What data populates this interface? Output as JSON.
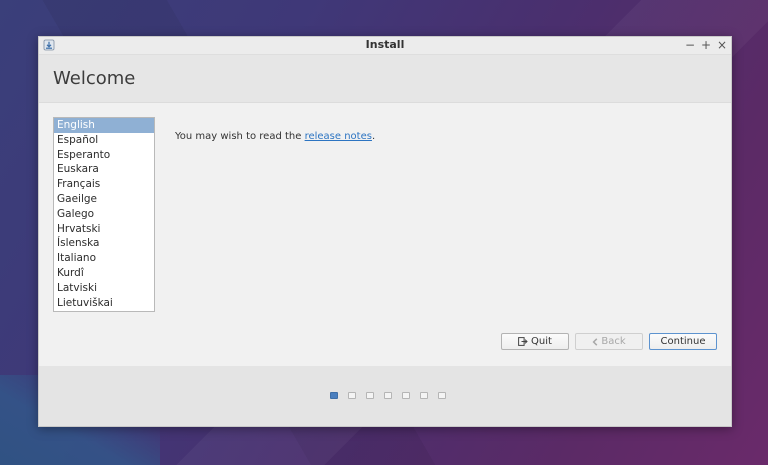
{
  "window": {
    "title": "Install",
    "controls": {
      "minimize": "−",
      "maximize": "+",
      "close": "×"
    }
  },
  "header": {
    "title": "Welcome"
  },
  "languages": {
    "selected_index": 0,
    "items": [
      "English",
      "Español",
      "Esperanto",
      "Euskara",
      "Français",
      "Gaeilge",
      "Galego",
      "Hrvatski",
      "Íslenska",
      "Italiano",
      "Kurdî",
      "Latviski",
      "Lietuviškai"
    ]
  },
  "notes": {
    "prefix": "You may wish to read the ",
    "link": "release notes",
    "suffix": "."
  },
  "buttons": {
    "quit": "Quit",
    "back": "Back",
    "continue": "Continue"
  },
  "progress": {
    "total_steps": 7,
    "current_step": 1
  },
  "colors": {
    "accent": "#4a7fbf",
    "link": "#2c74c2",
    "selection": "#8fb0d4"
  }
}
